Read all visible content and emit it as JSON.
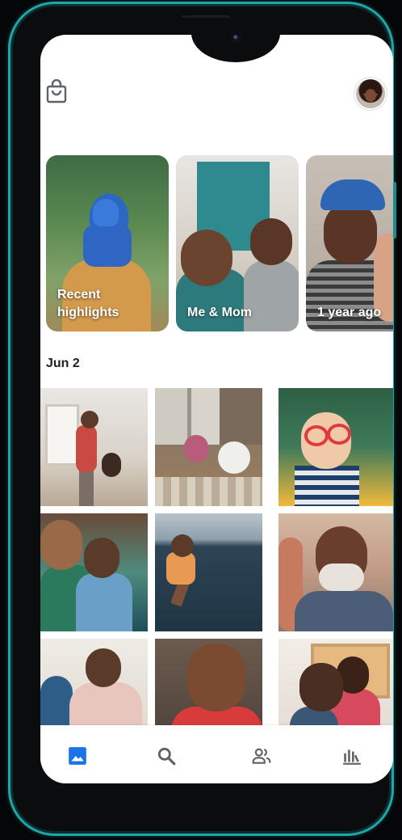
{
  "colors": {
    "accent": "#1a73e8",
    "nav_icon": "#5f6368",
    "frame_bezel": "#1fa6a8",
    "text_primary": "#202124"
  },
  "topbar": {
    "left_icon": "shopping-bag-icon",
    "right_icon": "profile-avatar"
  },
  "highlights": [
    {
      "label": "Recent\nhighlights"
    },
    {
      "label": "Me & Mom"
    },
    {
      "label": "1 year ago"
    }
  ],
  "section": {
    "date": "Jun 2"
  },
  "bottom_nav": [
    {
      "icon": "photos-icon",
      "active": true
    },
    {
      "icon": "search-icon",
      "active": false
    },
    {
      "icon": "sharing-icon",
      "active": false
    },
    {
      "icon": "library-icon",
      "active": false
    }
  ]
}
